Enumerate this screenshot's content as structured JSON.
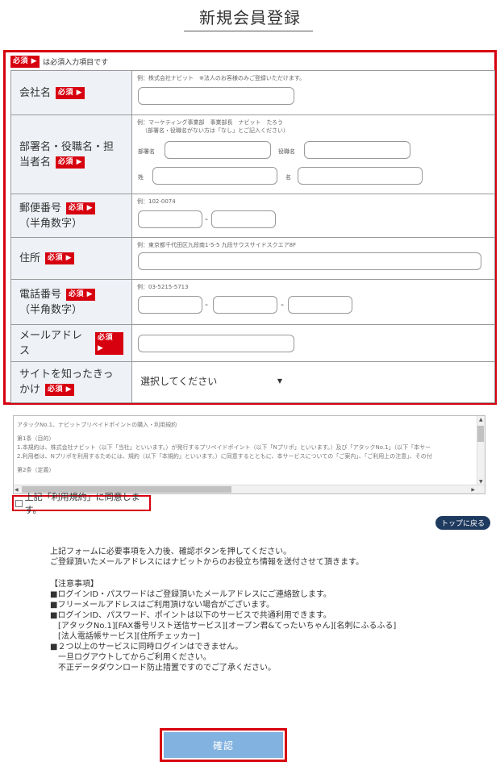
{
  "page": {
    "title": "新規会員登録"
  },
  "legend": {
    "badge": "必須 ▶",
    "text": "は必須入力項目です"
  },
  "required_badge": "必須 ▶",
  "fields": {
    "company": {
      "label": "会社名",
      "hint": "例：株式会社ナビット　※法人のお客様のみご登録いただけます。",
      "value": ""
    },
    "person": {
      "label": "部署名・役職名・担当者名",
      "hint1": "例：マーケティング事業部　事業部長　ナビット　たろう",
      "hint2": "（部署名・役職名がない方は「なし」とご記入ください）",
      "dept_label": "部署名",
      "title_label": "役職名",
      "last_label": "姓",
      "first_label": "名",
      "dept_value": "",
      "title_value": "",
      "last_value": "",
      "first_value": ""
    },
    "postal": {
      "label": "郵便番号",
      "label_sub": "（半角数字）",
      "hint": "例：102-0074",
      "part1": "",
      "part2": ""
    },
    "address": {
      "label": "住所",
      "hint": "例：東京都千代田区九段南1-5-5 九段サウスサイドスクエア8F",
      "value": ""
    },
    "phone": {
      "label": "電話番号",
      "label_sub": "（半角数字）",
      "hint": "例：03-5215-5713",
      "part1": "",
      "part2": "",
      "part3": ""
    },
    "email": {
      "label": "メールアドレス",
      "value": ""
    },
    "source": {
      "label": "サイトを知ったきっかけ",
      "selected": "選択してください"
    }
  },
  "terms": {
    "title": "アタックNo.1、ナビットプリペイドポイントの購入・利用規約",
    "article1": "第1条（目的）",
    "line1": "1.本規約は、株式会社ナビット（以下「当社」といいます。）が発行するプリペイドポイント（以下「Nプリポ」といいます。）及び「アタックNo.1」（以下「本サー",
    "line2": "2.利用者は、Nプリポを利用するためには、規約（以下「本規約」といいます。）に同意するとともに、本サービスについての「ご案内」、「ご利用上の注意」、その付",
    "article2": "第2条（定義）"
  },
  "agree": {
    "label": "上記「利用規約」に同意します。"
  },
  "top_button": "トップに戻る",
  "instructions": {
    "line1": "上記フォームに必要事項を入力後、確認ボタンを押してください。",
    "line2": "ご登録頂いたメールアドレスにはナビットからのお役立ち情報を送付させて頂きます。"
  },
  "notes": {
    "heading": "【注意事項】",
    "n1": "■ログインID・パスワードはご登録頂いたメールアドレスにご連絡致します。",
    "n2": "■フリーメールアドレスはご利用頂けない場合がございます。",
    "n3": "■ログインID、パスワード、ポイントは以下のサービスで共通利用できます。",
    "n3a": "　[アタックNo.1][FAX番号リスト送信サービス][オープン君&てったいちゃん][名刺にふるふる]",
    "n3b": "　[法人電話帳サービス][住所チェッカー]",
    "n4": "■２つ以上のサービスに同時ログインはできません。",
    "n4a": "　一旦ログアウトしてからご利用ください。",
    "n4b": "　不正データダウンロード防止措置ですのでご了承ください。"
  },
  "confirm_button": "確認",
  "colors": {
    "accent_red": "#d7000f",
    "label_bg": "#eef2f7",
    "confirm_blue": "#82b2e0",
    "top_button_bg": "#1f3a5f"
  }
}
